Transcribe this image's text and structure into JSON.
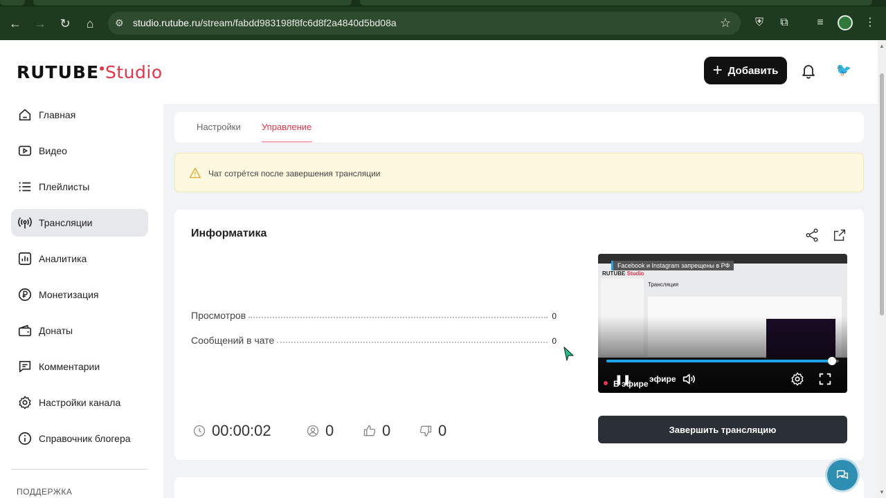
{
  "browser": {
    "url_host": "studio.rutube.ru",
    "url_path": "/stream/fabdd983198f8fc6d8f2a4840d5bd08a"
  },
  "header": {
    "logo_brand": "RUTUBE",
    "logo_product": "Studio",
    "add_button_label": "Добавить"
  },
  "sidebar": {
    "items": [
      {
        "label": "Главная",
        "icon": "home-icon"
      },
      {
        "label": "Видео",
        "icon": "video-icon"
      },
      {
        "label": "Плейлисты",
        "icon": "playlist-icon"
      },
      {
        "label": "Трансляции",
        "icon": "broadcast-icon",
        "active": true
      },
      {
        "label": "Аналитика",
        "icon": "analytics-icon"
      },
      {
        "label": "Монетизация",
        "icon": "ruble-icon"
      },
      {
        "label": "Донаты",
        "icon": "wallet-icon"
      },
      {
        "label": "Комментарии",
        "icon": "comment-icon"
      },
      {
        "label": "Настройки канала",
        "icon": "gear-icon"
      },
      {
        "label": "Справочник блогера",
        "icon": "info-icon"
      }
    ],
    "section_label": "ПОДДЕРЖКА"
  },
  "tabs": {
    "settings": "Настройки",
    "manage": "Управление",
    "active": "manage"
  },
  "warning": {
    "text": "Чат сотрётся после завершения трансляции"
  },
  "stream": {
    "title": "Информатика",
    "stats": [
      {
        "label": "Просмотров",
        "value": "0"
      },
      {
        "label": "Сообщений в чате",
        "value": "0"
      }
    ],
    "duration": "00:00:02",
    "viewers": "0",
    "likes": "0",
    "dislikes": "0",
    "end_button_label": "Завершить трансляцию"
  },
  "player": {
    "notice": "Facebook и Instagram запрещены в РФ",
    "live_label": "В эфире",
    "live_label_overlap": "эфире",
    "progress": 0.97,
    "inner_title": "Трансляция"
  },
  "colors": {
    "brand_red": "#e8334a",
    "accent_blue": "#1fa3e8",
    "dark_button": "#2b2f36"
  }
}
